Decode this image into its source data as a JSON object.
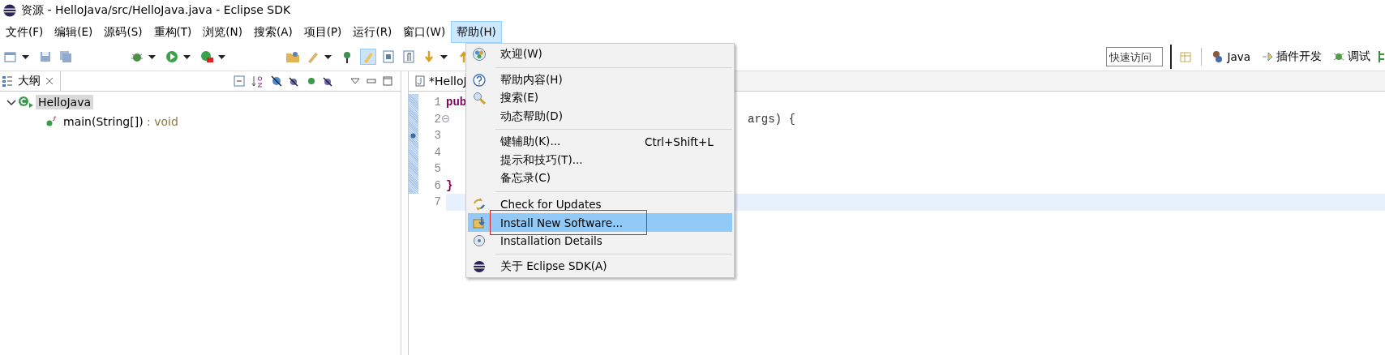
{
  "window": {
    "title": "资源 - HelloJava/src/HelloJava.java - Eclipse SDK"
  },
  "menu_bar": [
    {
      "label": "文件(F)",
      "selected": false
    },
    {
      "label": "编辑(E)",
      "selected": false
    },
    {
      "label": "源码(S)",
      "selected": false
    },
    {
      "label": "重构(T)",
      "selected": false
    },
    {
      "label": "浏览(N)",
      "selected": false
    },
    {
      "label": "搜索(A)",
      "selected": false
    },
    {
      "label": "项目(P)",
      "selected": false
    },
    {
      "label": "运行(R)",
      "selected": false
    },
    {
      "label": "窗口(W)",
      "selected": false
    },
    {
      "label": "帮助(H)",
      "selected": true
    }
  ],
  "help_menu": {
    "items": [
      {
        "kind": "item",
        "label": "欢迎(W)",
        "selected": false
      },
      {
        "kind": "separator"
      },
      {
        "kind": "item",
        "label": "帮助内容(H)",
        "selected": false
      },
      {
        "kind": "item",
        "label": "搜索(E)",
        "selected": false
      },
      {
        "kind": "item",
        "label": "动态帮助(D)",
        "selected": false
      },
      {
        "kind": "separator"
      },
      {
        "kind": "item",
        "label": "键辅助(K)...",
        "shortcut": "Ctrl+Shift+L",
        "selected": false
      },
      {
        "kind": "item",
        "label": "提示和技巧(T)...",
        "selected": false
      },
      {
        "kind": "item",
        "label": "备忘录(C)",
        "selected": false
      },
      {
        "kind": "separator"
      },
      {
        "kind": "item",
        "label": "Check for Updates",
        "selected": false
      },
      {
        "kind": "item",
        "label": "Install New Software...",
        "selected": true,
        "annotated": true
      },
      {
        "kind": "item",
        "label": "Installation Details",
        "selected": false
      },
      {
        "kind": "separator"
      },
      {
        "kind": "item",
        "label": "关于 Eclipse SDK(A)",
        "selected": false
      }
    ]
  },
  "quick_access": {
    "placeholder": "快速访问"
  },
  "perspectives": [
    {
      "label": "Java"
    },
    {
      "label": "插件开发"
    },
    {
      "label": "调试"
    }
  ],
  "outline": {
    "tab": "大纲",
    "tree": [
      {
        "label": "HelloJava",
        "expanded": true,
        "selected": true,
        "children": [
          {
            "label": "main(String[])",
            "type": " : void",
            "selected": false
          }
        ]
      }
    ]
  },
  "editor": {
    "tab": "*HelloJ",
    "lines": [
      {
        "number": "1",
        "left": "pub"
      },
      {
        "number": "2",
        "right": "args) {"
      },
      {
        "number": "3"
      },
      {
        "number": "4"
      },
      {
        "number": "5"
      },
      {
        "number": "6",
        "left": "}"
      },
      {
        "number": "7",
        "current": true
      }
    ]
  }
}
